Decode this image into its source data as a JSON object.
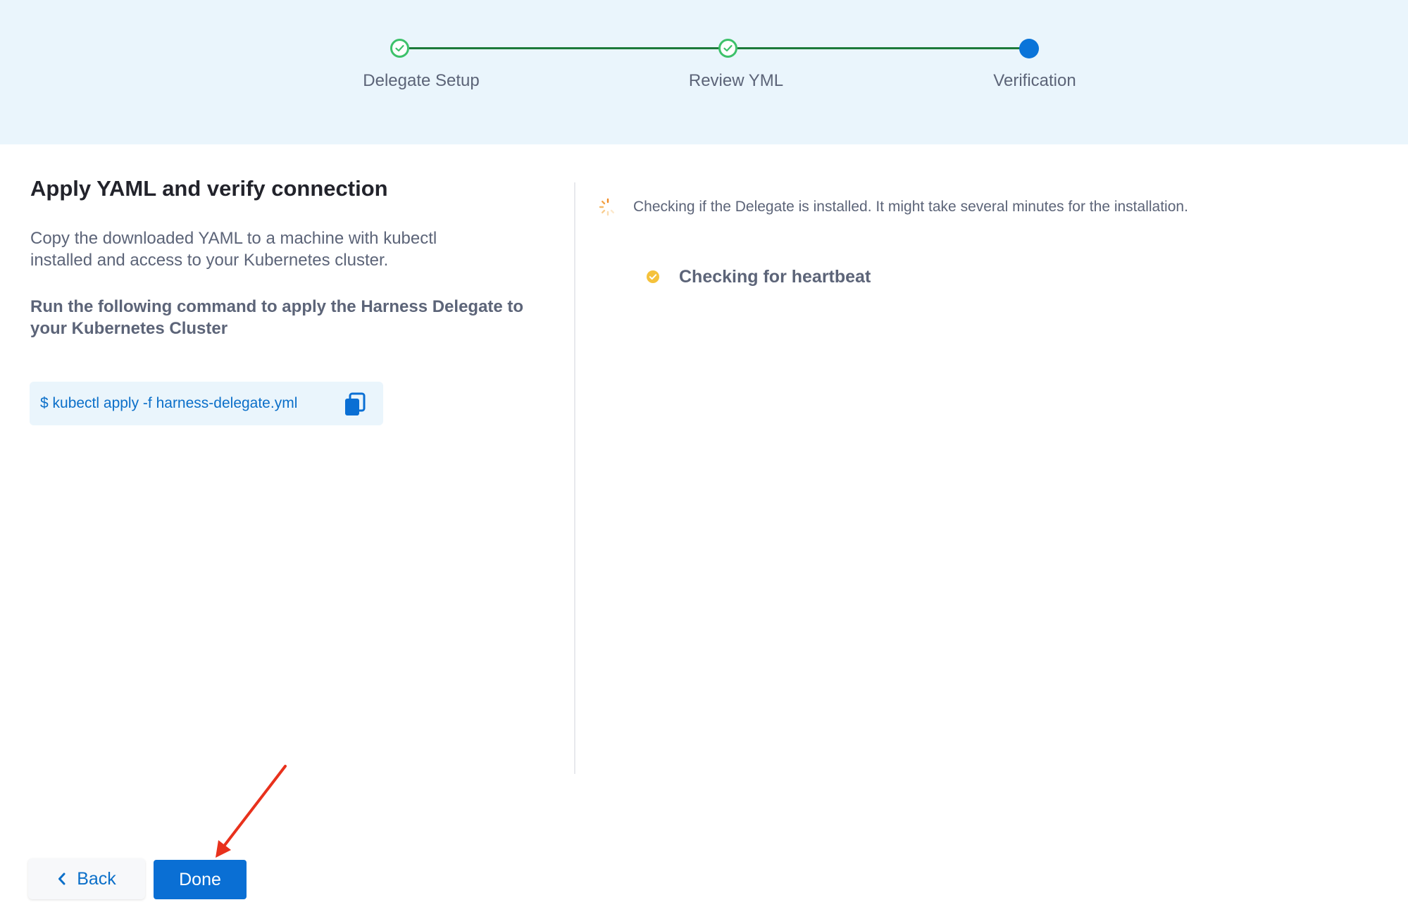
{
  "stepper": {
    "steps": [
      {
        "label": "Delegate Setup",
        "state": "done"
      },
      {
        "label": "Review YML",
        "state": "done"
      },
      {
        "label": "Verification",
        "state": "active"
      }
    ]
  },
  "left": {
    "title": "Apply YAML and verify connection",
    "description": "Copy the downloaded YAML to a machine with kubectl installed and access to your Kubernetes cluster.",
    "command_intro": "Run the following command to apply the Harness Delegate to your Kubernetes Cluster",
    "command": "$ kubectl apply -f harness-delegate.yml",
    "copy_icon": "copy-icon"
  },
  "right": {
    "status_text": "Checking if the Delegate is installed. It might take several minutes for the installation.",
    "heartbeat_text": "Checking for heartbeat",
    "status_icon": "spinner-icon",
    "heartbeat_icon": "check-circle-icon"
  },
  "footer": {
    "back_label": "Back",
    "done_label": "Done"
  },
  "colors": {
    "accent": "#0a74d9",
    "step_done": "#3dc16a",
    "heartbeat": "#f5c23b",
    "annotation_arrow": "#e8311c"
  }
}
